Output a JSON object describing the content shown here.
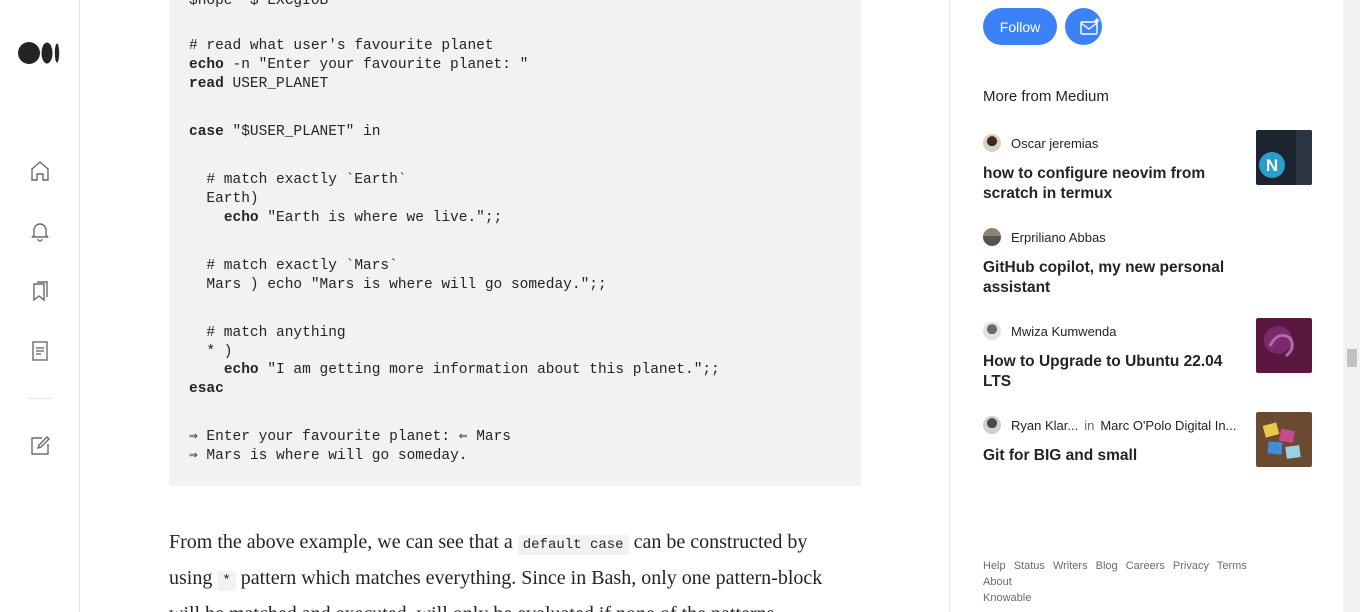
{
  "nav": {
    "icons": [
      "medium-logo-icon",
      "home-icon",
      "notifications-icon",
      "bookmarks-icon",
      "stories-icon",
      "write-icon"
    ]
  },
  "code": {
    "lines": [
      "$hope  $ EXCgIoB",
      "# read what user's favourite planet",
      "echo -n \"Enter your favourite planet: \"",
      "read USER_PLANET",
      "case \"$USER_PLANET\" in",
      "  # match exactly `Earth`",
      "  Earth)",
      "    echo \"Earth is where we live.\";;",
      "  # match exactly `Mars`",
      "  Mars ) echo \"Mars is where will go someday.\";;",
      "  # match anything",
      "  * )",
      "    echo \"I am getting more information about this planet.\";;",
      "esac",
      "⇒ Enter your favourite planet: ⇐ Mars",
      "⇒ Mars is where will go someday."
    ]
  },
  "article": {
    "p1_a": "From the above example, we can see that a ",
    "p1_code": "default case",
    "p1_b": " can be constructed by",
    "p2_a": "using ",
    "p2_code": "*",
    "p2_b": " pattern which matches everything. Since in Bash, only one pattern-block",
    "p3": "will be matched and executed,    will only be evaluated if none of the patterns"
  },
  "sidebar": {
    "follow_label": "Follow",
    "more_title": "More from Medium",
    "recommendations": [
      {
        "author": "Oscar jeremias",
        "publication": "",
        "title": "how to configure neovim from scratch in termux",
        "has_thumb": true
      },
      {
        "author": "Erpriliano Abbas",
        "publication": "",
        "title": "GitHub copilot, my new personal assistant",
        "has_thumb": false
      },
      {
        "author": "Mwiza Kumwenda",
        "publication": "",
        "title": "How to Upgrade to Ubuntu 22.04 LTS",
        "has_thumb": true
      },
      {
        "author": "Ryan Klar...",
        "in": "in",
        "publication": "Marc O'Polo Digital In...",
        "title": "Git for BIG and small",
        "has_thumb": true
      }
    ],
    "footer": [
      "Help",
      "Status",
      "Writers",
      "Blog",
      "Careers",
      "Privacy",
      "Terms",
      "About",
      "Knowable"
    ]
  },
  "colors": {
    "accent": "#3b82f6",
    "code_bg": "#f2f2f2",
    "text": "#242424",
    "muted": "#6b6b6b"
  }
}
